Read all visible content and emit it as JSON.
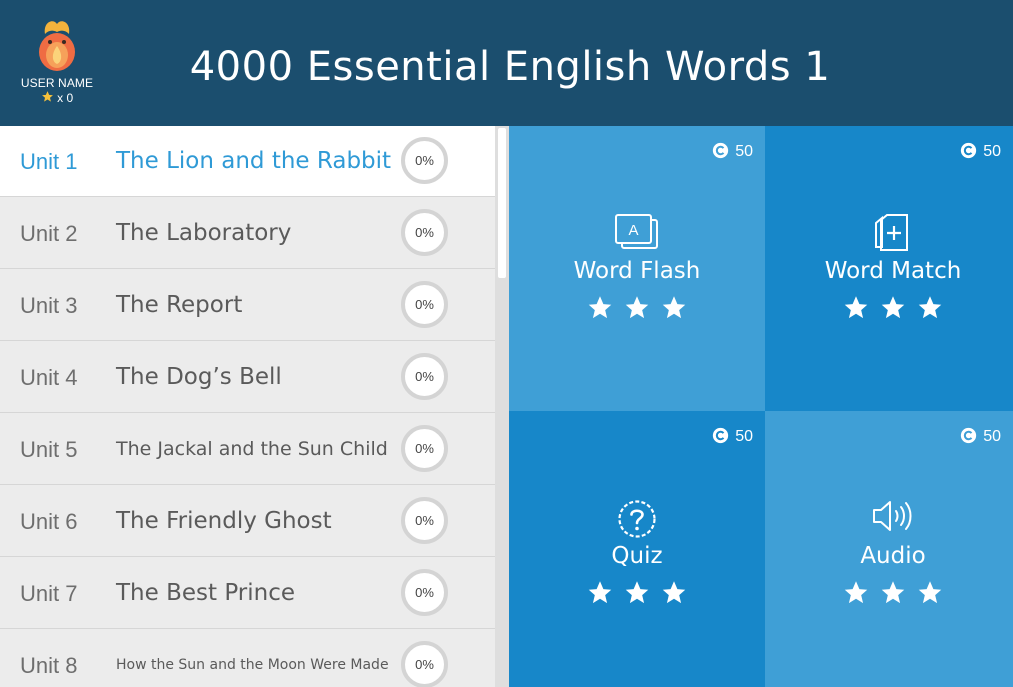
{
  "header": {
    "title": "4000 Essential English Words 1",
    "user_name": "USER NAME",
    "star_count": "x 0"
  },
  "units": [
    {
      "unit": "Unit 1",
      "title": "The Lion and the Rabbit",
      "progress": "0%",
      "active": true
    },
    {
      "unit": "Unit 2",
      "title": "The Laboratory",
      "progress": "0%"
    },
    {
      "unit": "Unit 3",
      "title": "The Report",
      "progress": "0%"
    },
    {
      "unit": "Unit 4",
      "title": "The Dog’s Bell",
      "progress": "0%"
    },
    {
      "unit": "Unit 5",
      "title": "The Jackal and the Sun Child",
      "progress": "0%"
    },
    {
      "unit": "Unit 6",
      "title": "The Friendly Ghost",
      "progress": "0%"
    },
    {
      "unit": "Unit 7",
      "title": "The Best Prince",
      "progress": "0%"
    },
    {
      "unit": "Unit 8",
      "title": "How the Sun and the Moon Were Made",
      "progress": "0%"
    }
  ],
  "activities": [
    {
      "label": "Word Flash",
      "coins": "50",
      "icon": "word-flash-icon",
      "stars": 3,
      "color": "#3f9fd6"
    },
    {
      "label": "Word Match",
      "coins": "50",
      "icon": "word-match-icon",
      "stars": 3,
      "color": "#1787c9"
    },
    {
      "label": "Quiz",
      "coins": "50",
      "icon": "quiz-icon",
      "stars": 3,
      "color": "#1787c9"
    },
    {
      "label": "Audio",
      "coins": "50",
      "icon": "audio-icon",
      "stars": 3,
      "color": "#3f9fd6"
    }
  ],
  "colors": {
    "header_bg": "#1b4e6e",
    "accent": "#2f9ad6",
    "list_bg": "#ececec"
  }
}
